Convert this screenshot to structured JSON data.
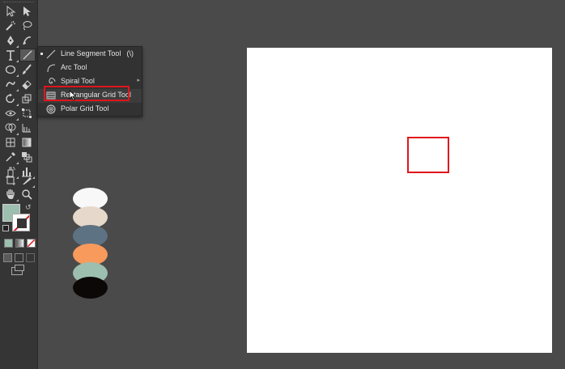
{
  "flyout": {
    "items": [
      {
        "label": "Line Segment Tool",
        "shortcut": "(\\)",
        "icon": "line-segment-icon"
      },
      {
        "label": "Arc Tool",
        "icon": "arc-icon"
      },
      {
        "label": "Spiral Tool",
        "icon": "spiral-icon"
      },
      {
        "label": "Rectangular Grid Tool",
        "icon": "rectangular-grid-icon",
        "highlighted": true
      },
      {
        "label": "Polar Grid Tool",
        "icon": "polar-grid-icon"
      }
    ]
  },
  "fill_color": "#9dbfb0",
  "highlight_color": "#e0151b",
  "swatches": [
    "#f8f8f8",
    "#e6d8ca",
    "#5d7283",
    "#f79a5c",
    "#9dbfb0",
    "#0c0807"
  ],
  "toolbar_icons": [
    "selection-icon",
    "direct-selection-icon",
    "magic-wand-icon",
    "lasso-icon",
    "pen-icon",
    "curvature-icon",
    "type-icon",
    "line-segment-icon",
    "ellipse-icon",
    "paintbrush-icon",
    "shaper-icon",
    "eraser-icon",
    "rotate-icon",
    "scale-icon",
    "width-icon",
    "free-transform-icon",
    "shape-builder-icon",
    "perspective-grid-icon",
    "mesh-icon",
    "gradient-icon",
    "eyedropper-icon",
    "blend-icon",
    "symbol-sprayer-icon",
    "column-graph-icon",
    "artboard-icon",
    "slice-icon",
    "hand-icon",
    "zoom-icon"
  ]
}
